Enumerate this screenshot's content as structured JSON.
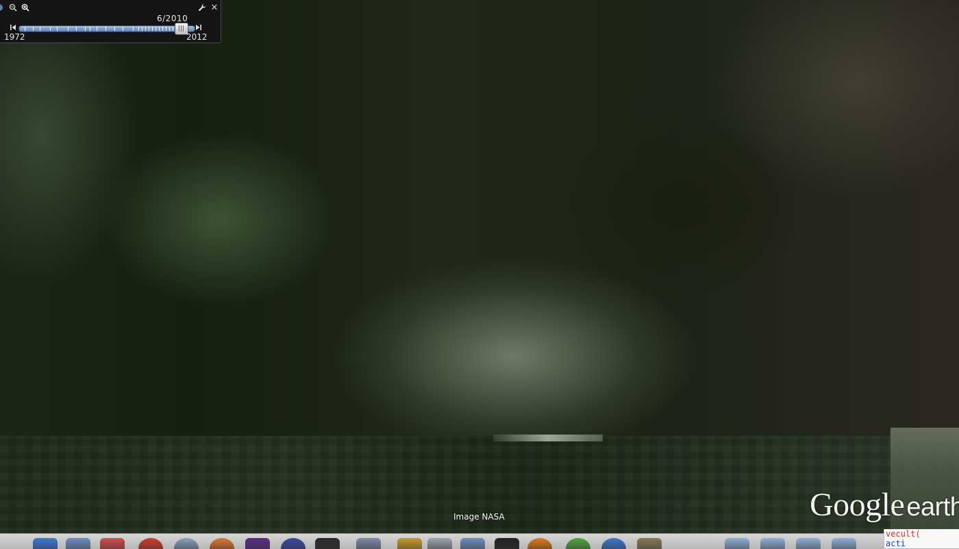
{
  "time_slider": {
    "current_date": "6/2010",
    "start_year": "1972",
    "end_year": "2012",
    "position_fraction": 0.96
  },
  "attribution": "Image NASA",
  "logo": {
    "google": "Google",
    "earth": "earth"
  },
  "code_overlay": {
    "line1": "vecult(",
    "line2": "acti"
  },
  "icons": {
    "zoom_out": "zoom-out-icon",
    "zoom_in": "zoom-in-icon",
    "settings": "wrench-icon",
    "close": "close-icon",
    "prev": "skip-back-icon",
    "next": "skip-forward-icon"
  },
  "colors": {
    "track_top": "#a9bfe0",
    "track_bottom": "#5b7fb8",
    "panel_bg": "#141414"
  },
  "dock": {
    "items": [
      {
        "name": "finder",
        "color": "#3a7bd5"
      },
      {
        "name": "preview",
        "color": "#6d8fc7"
      },
      {
        "name": "calendar",
        "color": "#d44c4c"
      },
      {
        "name": "app-red",
        "color": "#d23c2c"
      },
      {
        "name": "safari",
        "color": "#8aa1c0"
      },
      {
        "name": "firefox",
        "color": "#e0762b"
      },
      {
        "name": "visual-studio",
        "color": "#5b2c8c"
      },
      {
        "name": "network",
        "color": "#3a4aa3"
      },
      {
        "name": "terminal",
        "color": "#2a2a2a"
      },
      {
        "name": "virtualbox",
        "color": "#7d8aa8"
      },
      {
        "name": "pencil",
        "color": "#c89b2c"
      },
      {
        "name": "mail",
        "color": "#9aa3ad"
      },
      {
        "name": "calculator",
        "color": "#6f8fbf"
      },
      {
        "name": "alien",
        "color": "#222222"
      },
      {
        "name": "vlc",
        "color": "#e07a1c"
      },
      {
        "name": "evernote",
        "color": "#4fa83d"
      },
      {
        "name": "chrome-blue",
        "color": "#3b79cc"
      },
      {
        "name": "photos",
        "color": "#8a7a55"
      },
      {
        "name": "folder-1",
        "color": "#8fb0d6"
      },
      {
        "name": "folder-2",
        "color": "#8fb0d6"
      },
      {
        "name": "folder-3",
        "color": "#8fb0d6"
      },
      {
        "name": "folder-4",
        "color": "#8fb0d6"
      }
    ]
  }
}
